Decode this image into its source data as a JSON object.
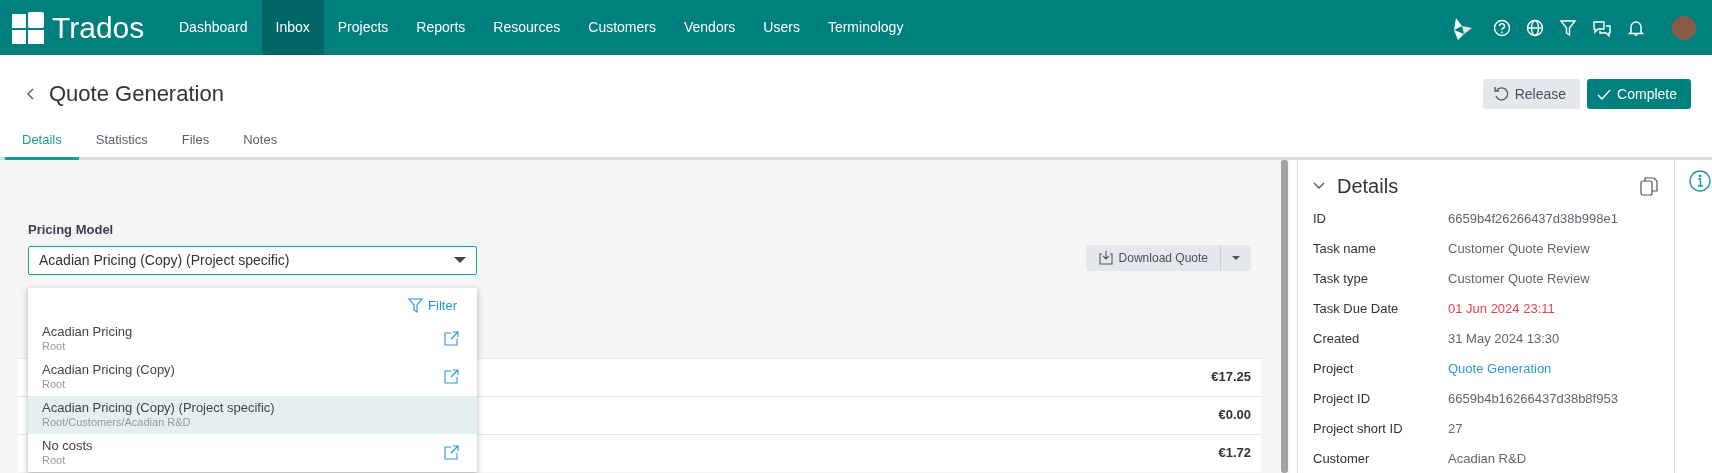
{
  "nav": {
    "brand": "Trados",
    "items": [
      {
        "label": "Dashboard",
        "selected": false
      },
      {
        "label": "Inbox",
        "selected": true
      },
      {
        "label": "Projects",
        "selected": false
      },
      {
        "label": "Reports",
        "selected": false
      },
      {
        "label": "Resources",
        "selected": false
      },
      {
        "label": "Customers",
        "selected": false
      },
      {
        "label": "Vendors",
        "selected": false
      },
      {
        "label": "Users",
        "selected": false
      },
      {
        "label": "Terminology",
        "selected": false
      }
    ]
  },
  "header": {
    "title": "Quote Generation",
    "buttons": [
      {
        "label": "Release",
        "kind": "secondary"
      },
      {
        "label": "Complete",
        "kind": "primary"
      }
    ]
  },
  "tabs": [
    {
      "label": "Details",
      "selected": true
    },
    {
      "label": "Statistics",
      "selected": false
    },
    {
      "label": "Files",
      "selected": false
    },
    {
      "label": "Notes",
      "selected": false
    }
  ],
  "pricing": {
    "label": "Pricing Model",
    "value": "Acadian Pricing (Copy) (Project specific)",
    "expanded": true,
    "filter": "Filter",
    "options": [
      {
        "name": "Acadian Pricing",
        "path": "Root",
        "selected": false
      },
      {
        "name": "Acadian Pricing (Copy)",
        "path": "Root",
        "selected": false
      },
      {
        "name": "Acadian Pricing (Copy) (Project specific)",
        "path": "Root/Customers/Acadian R&D",
        "selected": true
      },
      {
        "name": "No costs",
        "path": "Root",
        "selected": false
      }
    ]
  },
  "download_button": {
    "label": "Download Quote"
  },
  "cost_rows": [
    {
      "amount": "€17.25"
    },
    {
      "amount": "€0.00"
    },
    {
      "amount": "€1.72"
    }
  ],
  "details": {
    "title": "Details",
    "expanded": true,
    "fields": [
      {
        "label": "ID",
        "value": "6659b4f26266437d38b998e1",
        "kind": "text"
      },
      {
        "label": "Task name",
        "value": "Customer Quote Review",
        "kind": "text"
      },
      {
        "label": "Task type",
        "value": "Customer Quote Review",
        "kind": "text"
      },
      {
        "label": "Task Due Date",
        "value": "01 Jun 2024 23:11",
        "kind": "overdue"
      },
      {
        "label": "Created",
        "value": "31 May 2024 13:30",
        "kind": "text"
      },
      {
        "label": "Project",
        "value": "Quote Generation",
        "kind": "link"
      },
      {
        "label": "Project ID",
        "value": "6659b4b16266437d38b8f953",
        "kind": "text"
      },
      {
        "label": "Project short ID",
        "value": "27",
        "kind": "text"
      },
      {
        "label": "Customer",
        "value": "Acadian R&D",
        "kind": "text"
      }
    ]
  }
}
